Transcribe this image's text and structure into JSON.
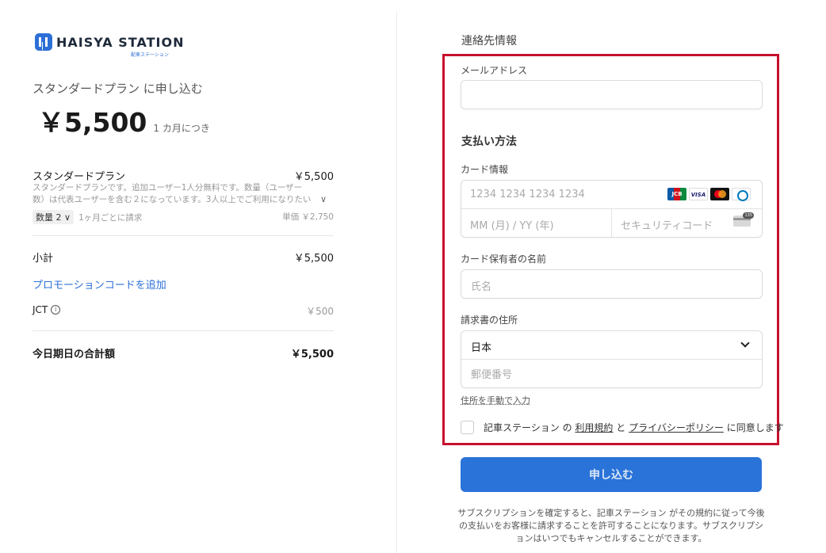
{
  "brand": {
    "name": "HAISYA STATION",
    "sub": "配車ステーション",
    "accent": "#2d6fd6"
  },
  "summary": {
    "plan_title": "スタンダードプラン に申し込む",
    "price": "￥5,500",
    "period": "1 カ月につき",
    "item": {
      "name": "スタンダードプラン",
      "price": "￥5,500",
      "description": "スタンダードプランです。追加ユーザー1人分無料です。数量（ユーザー数）は代表ユーザーを含む２になっています。3人以上でご利用になりたい場合は...",
      "quantity_label": "数量 2",
      "billing_note": "1ヶ月ごとに請求",
      "unit_price": "単価 ￥2,750"
    },
    "subtotal_label": "小計",
    "subtotal_value": "￥5,500",
    "promo_link": "プロモーションコードを追加",
    "tax_label": "JCT",
    "tax_value": "￥500",
    "total_label": "今日期日の合計額",
    "total_value": "￥5,500"
  },
  "form": {
    "contact_title": "連絡先情報",
    "email_label": "メールアドレス",
    "email_value": "",
    "payment_title": "支払い方法",
    "card_label": "カード情報",
    "card_number_placeholder": "1234 1234 1234 1234",
    "expiry_placeholder": "MM (月) / YY (年)",
    "cvc_placeholder": "セキュリティコード",
    "card_brands": [
      "JCB",
      "VISA",
      "Mastercard",
      "Diners"
    ],
    "holder_label": "カード保有者の名前",
    "holder_placeholder": "氏名",
    "address_label": "請求書の住所",
    "country_value": "日本",
    "postal_placeholder": "郵便番号",
    "manual_address_link": "住所を手動で入力",
    "agree_prefix": "記車ステーション の",
    "terms_link": "利用規約",
    "agree_and": "と",
    "privacy_link": "プライバシーポリシー",
    "agree_suffix": "に同意します",
    "submit_label": "申し込む",
    "footnote": "サブスクリプションを確定すると、記車ステーション がその規約に従って今後の支払いをお客様に請求することを許可することになります。サブスクリプションはいつでもキャンセルすることができます。"
  },
  "colors": {
    "highlight_frame": "#c8102e",
    "submit_button": "#2a73d9"
  }
}
